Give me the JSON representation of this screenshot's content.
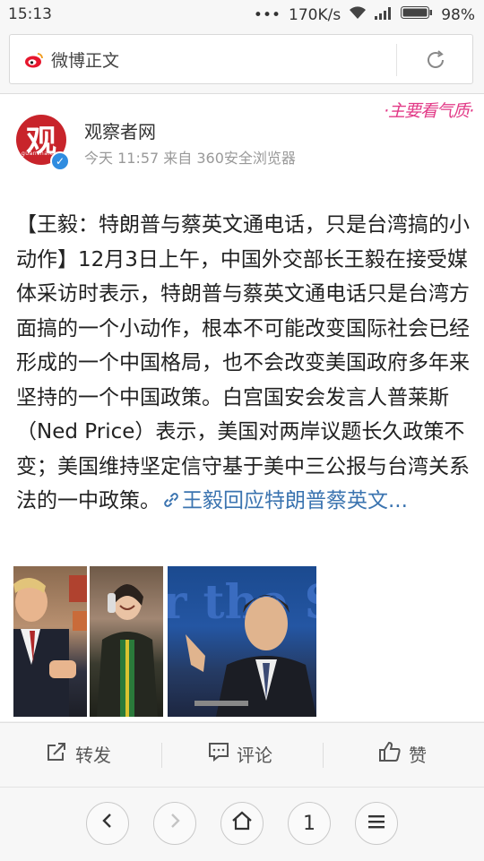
{
  "status_bar": {
    "time": "15:13",
    "dots": "•••",
    "speed": "170K/s",
    "battery": "98%"
  },
  "browser": {
    "url_title": "微博正文"
  },
  "post": {
    "author": "观察者网",
    "avatar_char": "观",
    "avatar_sub": "guancha.cn",
    "meta": "今天 11:57 来自 360安全浏览器",
    "watermark": "·主要看气质·",
    "text": "【王毅：特朗普与蔡英文通电话，只是台湾搞的小动作】12月3日上午，中国外交部长王毅在接受媒体采访时表示，特朗普与蔡英文通电话只是台湾方面搞的一个小动作，根本不可能改变国际社会已经形成的一个中国格局，也不会改变美国政府多年来坚持的一个中国政策。白宫国安会发言人普莱斯（Ned Price）表示，美国对两岸议题长久政策不变；美国维持坚定信守基于美中三公报与台湾关系法的一中政策。",
    "link_text": "王毅回应特朗普蔡英文...",
    "photo3_caption": "r the S"
  },
  "actions": {
    "repost": "转发",
    "comment": "评论",
    "like": "赞"
  },
  "nav": {
    "tabs_count": "1"
  },
  "colors": {
    "link": "#3b74b0",
    "avatar_red": "#c8242b",
    "verify_blue": "#2f8ce0",
    "watermark_pink": "#e23a87"
  },
  "icons": [
    "weibo-icon",
    "reload-icon",
    "verified-icon",
    "link-icon",
    "repost-icon",
    "comment-icon",
    "like-icon",
    "back-icon",
    "forward-icon",
    "home-icon",
    "tabs-icon",
    "menu-icon",
    "wifi-icon",
    "signal-icon",
    "battery-icon"
  ]
}
